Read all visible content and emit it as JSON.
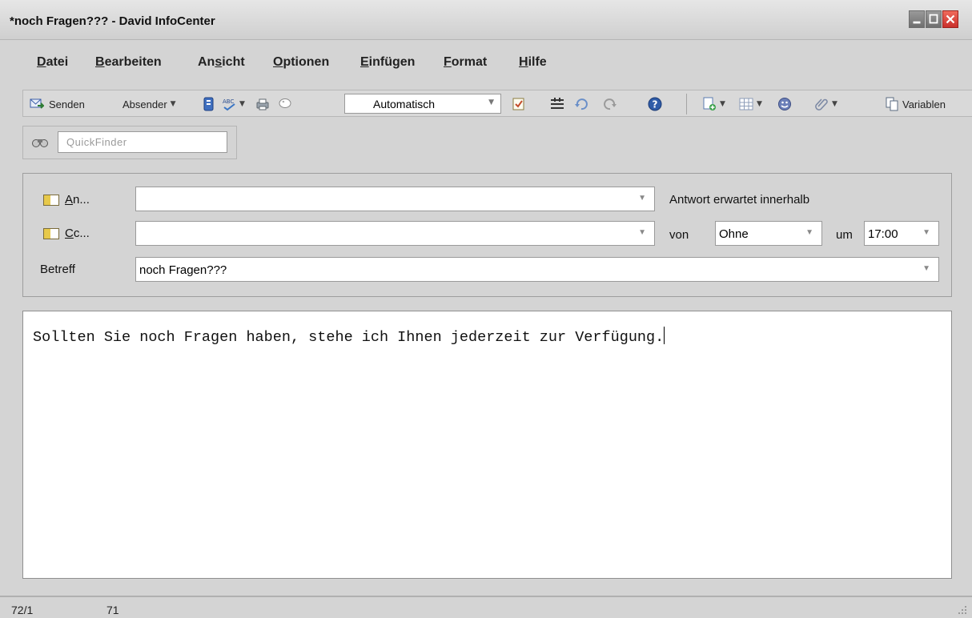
{
  "window": {
    "title": "*noch Fragen??? - David InfoCenter",
    "buttons": [
      "minimize-button",
      "maximize-button",
      "close-button"
    ]
  },
  "menu": {
    "items": [
      {
        "accel": "D",
        "rest": "atei"
      },
      {
        "accel": "B",
        "rest": "earbeiten"
      },
      {
        "pre": "An",
        "accel": "s",
        "rest": "icht"
      },
      {
        "accel": "O",
        "rest": "ptionen"
      },
      {
        "accel": "E",
        "rest": "infügen"
      },
      {
        "accel": "F",
        "rest": "ormat"
      },
      {
        "accel": "H",
        "rest": "ilfe"
      }
    ]
  },
  "toolbar": {
    "send_label": "Senden",
    "sender_label": "Absender",
    "priority_value": "Automatisch",
    "variables_label": "Variablen"
  },
  "quickfinder": {
    "placeholder": "QuickFinder"
  },
  "header": {
    "to_label_accel": "A",
    "to_label_rest": "n...",
    "cc_label_accel": "C",
    "cc_label_rest": "c...",
    "subject_label": "Betreff",
    "to_value": "",
    "cc_value": "",
    "subject_value": "noch Fragen???",
    "reply_expected_label": "Antwort erwartet innerhalb",
    "from_label": "von",
    "from_value": "Ohne",
    "at_label": "um",
    "at_value": "17:00"
  },
  "body": {
    "text": "Sollten Sie noch Fragen haben, stehe ich Ihnen jederzeit zur Verfügung."
  },
  "status": {
    "position": "72/1",
    "count": "71"
  },
  "colors": {
    "window_bg": "#d4d4d4",
    "close_red": "#d9362f",
    "field_bg": "#ffffff"
  }
}
